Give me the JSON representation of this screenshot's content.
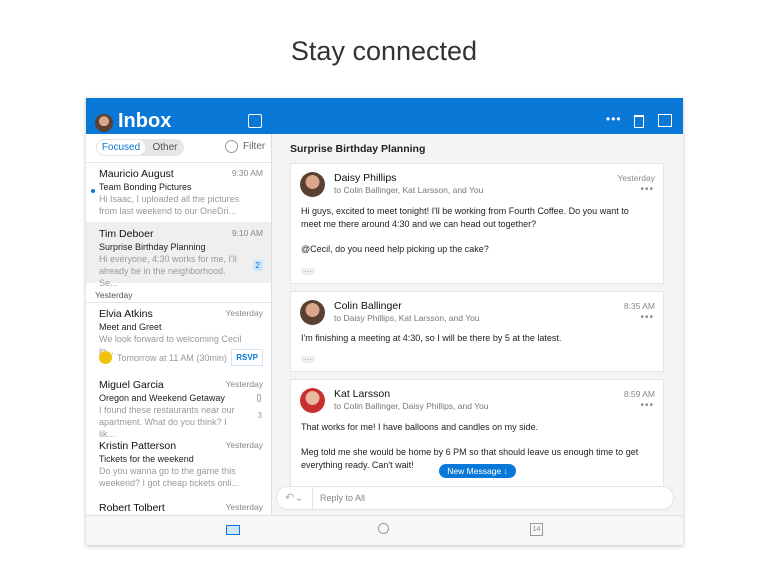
{
  "headline": "Stay connected",
  "header": {
    "title": "Inbox"
  },
  "left": {
    "tabs": [
      "Focused",
      "Other"
    ],
    "filter": "Filter",
    "section_yesterday": "Yesterday",
    "messages": [
      {
        "name": "Mauricio August",
        "time": "9:30 AM",
        "subject": "Team Bonding Pictures",
        "preview": "Hi Isaac, I uploaded all the pictures from last weekend to our OneDri..."
      },
      {
        "name": "Tim Deboer",
        "time": "9:10 AM",
        "subject": "Surprise Birthday Planning",
        "preview": "Hi everyone, 4:30 works for me, I'll already be in the neighborhood. Se...",
        "count": "2"
      },
      {
        "name": "Elvia Atkins",
        "time": "Yesterday",
        "subject": "Meet and Greet",
        "preview": "We look forward to welcoming Cecil in...",
        "event": "Tomorrow at 11 AM (30min)",
        "rsvp": "RSVP"
      },
      {
        "name": "Miguel Garcia",
        "time": "Yesterday",
        "subject": "Oregon and Weekend Getaway",
        "preview": "I found these restaurants near our apartment. What do you think? I lik...",
        "count": "3"
      },
      {
        "name": "Kristin Patterson",
        "time": "Yesterday",
        "subject": "Tickets for the weekend",
        "preview": "Do you wanna go to the game this weekend? I got cheap tickets onli..."
      },
      {
        "name": "Robert Tolbert",
        "time": "Yesterday"
      }
    ]
  },
  "thread": {
    "subject": "Surprise Birthday Planning",
    "messages": [
      {
        "from": "Daisy Phillips",
        "to": "to Colin Ballinger, Kat Larsson, and You",
        "time": "Yesterday",
        "body1": "Hi guys, excited to meet tonight! I'll be working from Fourth Coffee. Do you want to meet me there around 4:30 and we can head out together?",
        "body2": "@Cecil, do you need help picking up the cake?"
      },
      {
        "from": "Colin Ballinger",
        "to": "to Daisy Phillips, Kat Larsson, and You",
        "time": "8:35 AM",
        "body1": "I'm finishing a meeting at 4:30, so I will be there by 5 at the latest."
      },
      {
        "from": "Kat Larsson",
        "to": "to Colin Ballinger, Daisy Phillips, and You",
        "time": "8:59 AM",
        "body1": "That works for me! I have balloons and candles on my side.",
        "body2": "Meg told me she would be home by 6 PM so that should leave us enough time to get everything ready. Can't wait!"
      }
    ],
    "new_message": "New Message ↓",
    "reply_placeholder": "Reply to All"
  },
  "tabbar": {
    "calendar_day": "14"
  },
  "colors": {
    "accent": "#0a78d7"
  }
}
